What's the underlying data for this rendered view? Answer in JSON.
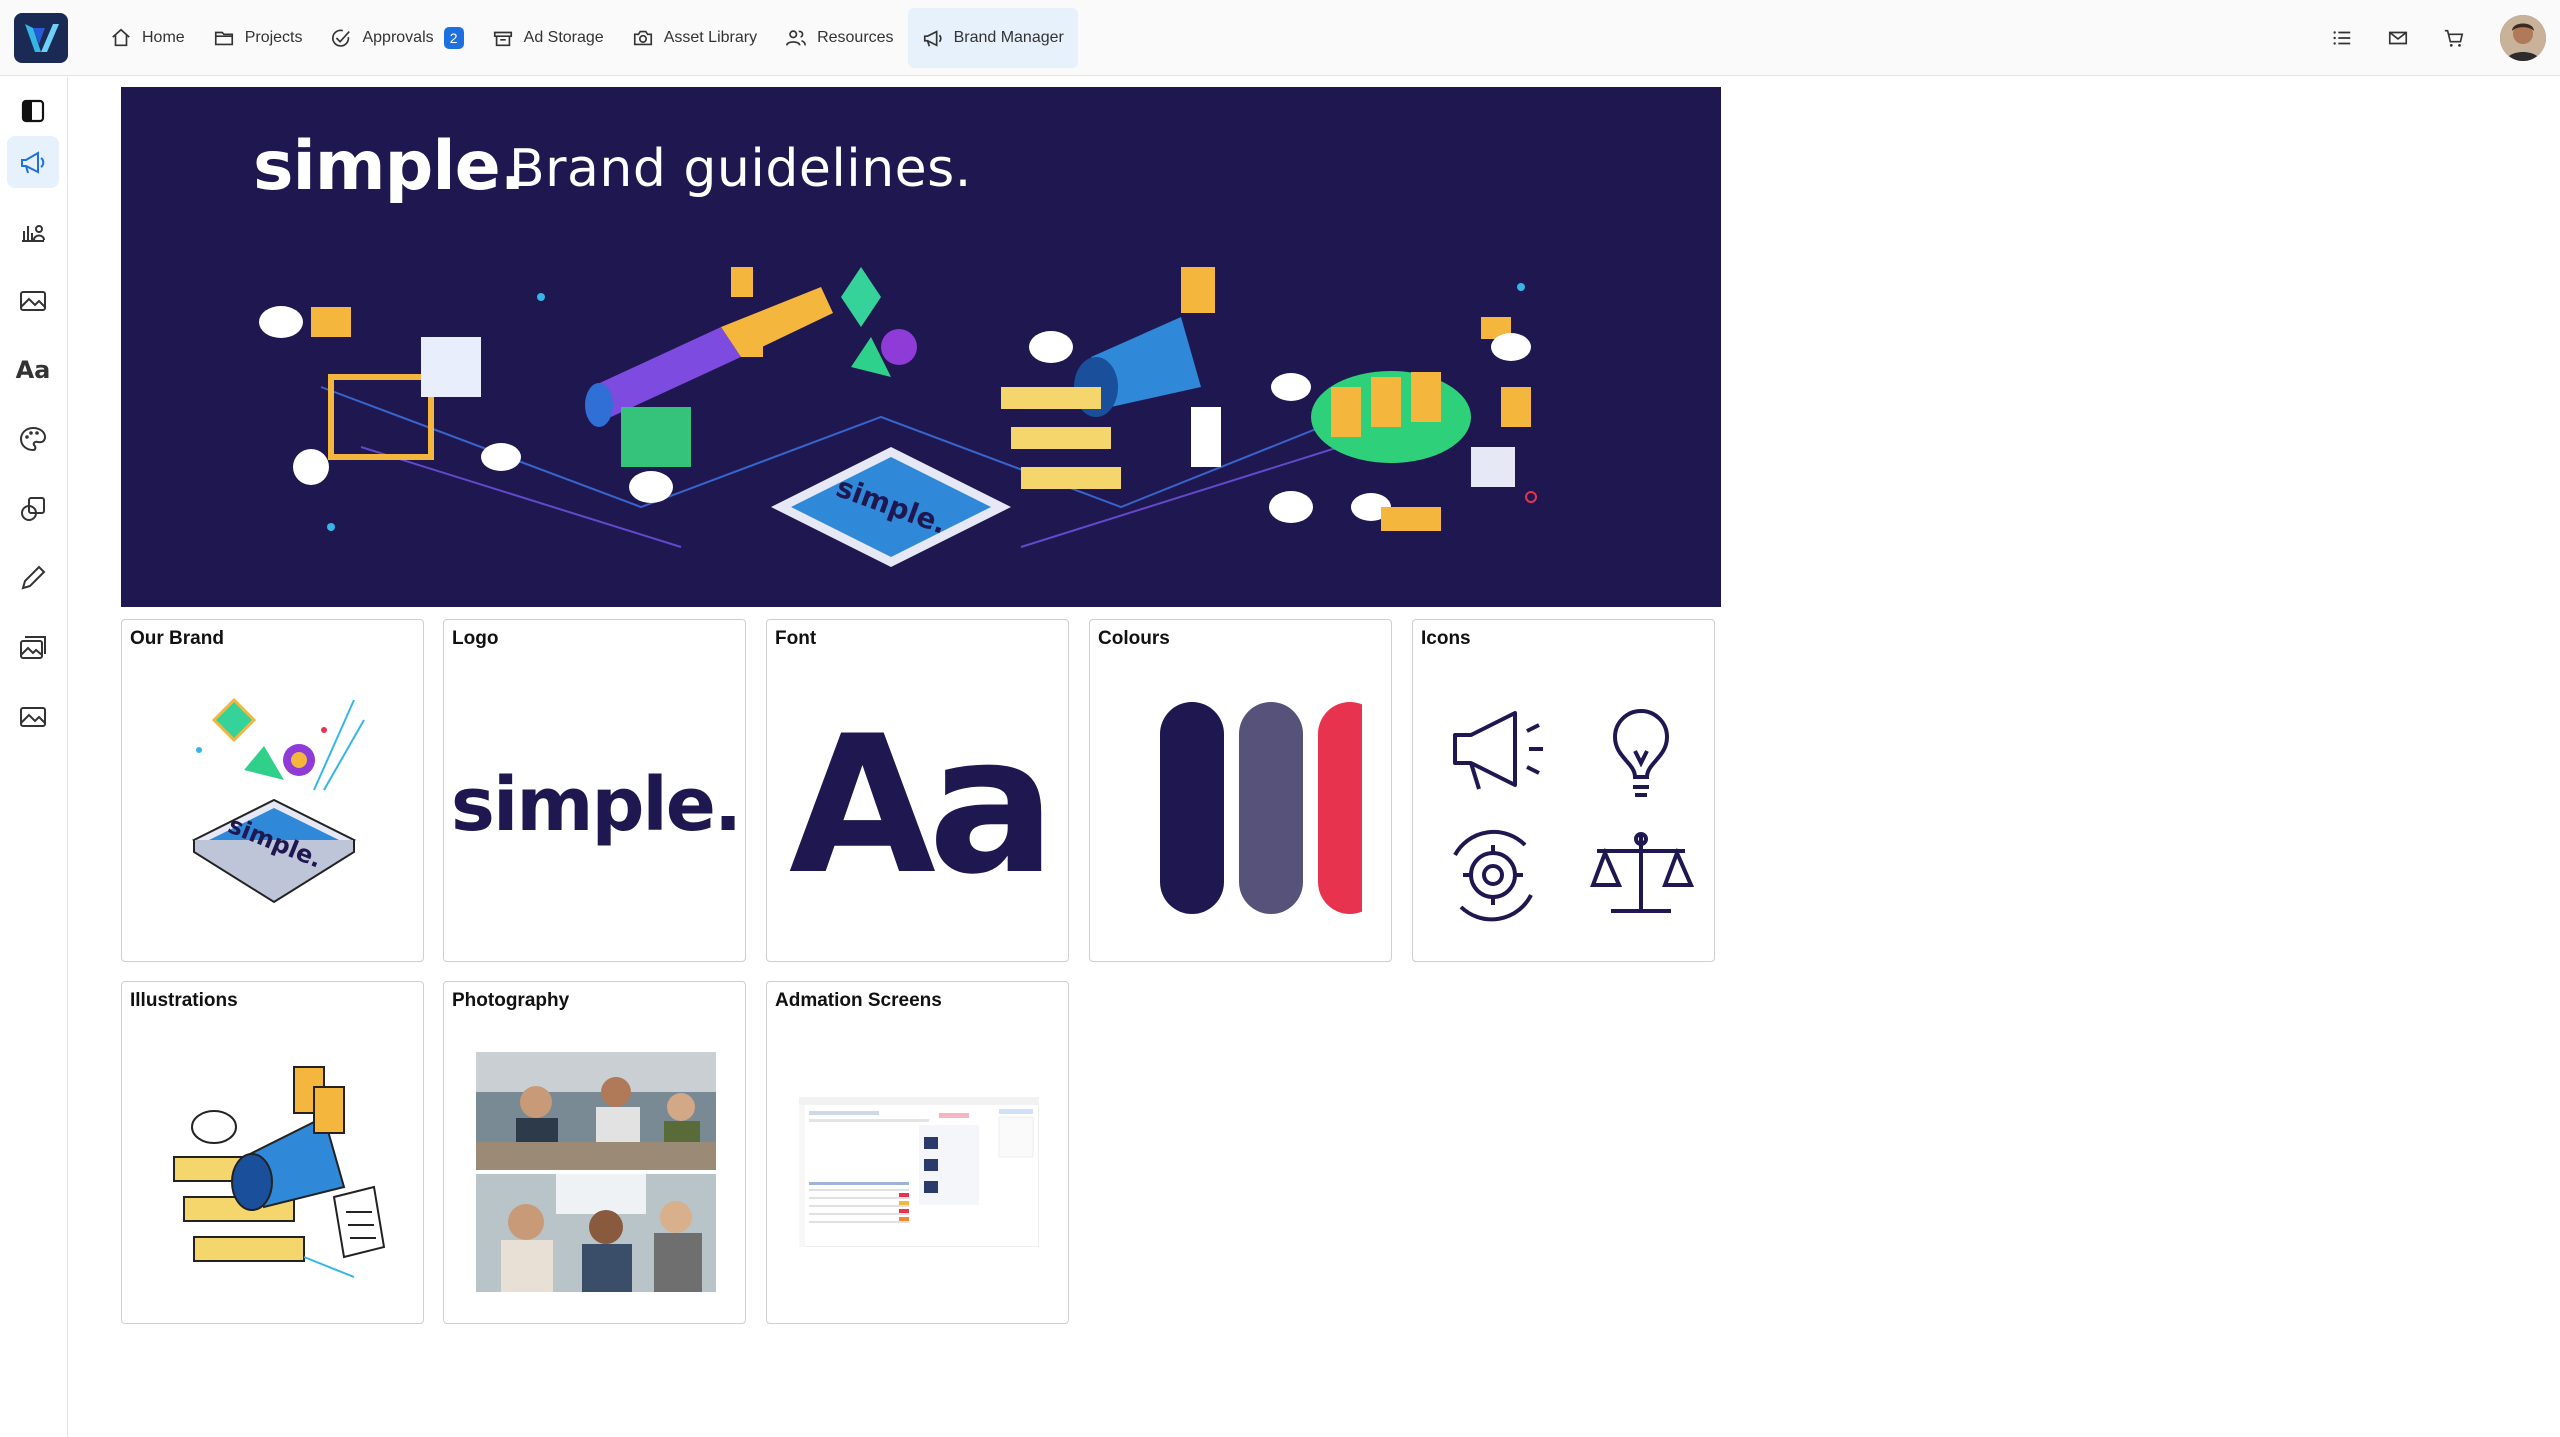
{
  "nav": {
    "items": [
      {
        "label": "Home",
        "icon": "home-icon"
      },
      {
        "label": "Projects",
        "icon": "folder-icon"
      },
      {
        "label": "Approvals",
        "icon": "check-circle-icon",
        "badge": "2"
      },
      {
        "label": "Ad Storage",
        "icon": "archive-icon"
      },
      {
        "label": "Asset Library",
        "icon": "camera-icon"
      },
      {
        "label": "Resources",
        "icon": "users-icon"
      },
      {
        "label": "Brand Manager",
        "icon": "megaphone-icon",
        "active": true
      }
    ]
  },
  "top_right": {
    "icons": [
      "list-icon",
      "mail-icon",
      "cart-icon",
      "avatar"
    ]
  },
  "sidebar": {
    "items": [
      "sidebar-toggle-icon",
      "megaphone-icon",
      "chart-people-icon",
      "image-icon",
      "font-icon",
      "palette-icon",
      "shapes-icon",
      "pen-icon",
      "photo-album-icon",
      "image-icon"
    ],
    "font_label": "Aa"
  },
  "hero": {
    "wordmark": "simple.",
    "title": "Brand guidelines."
  },
  "cards": [
    {
      "title": "Our Brand"
    },
    {
      "title": "Logo",
      "wordmark": "simple."
    },
    {
      "title": "Font",
      "sample": "Aa"
    },
    {
      "title": "Colours"
    },
    {
      "title": "Icons"
    },
    {
      "title": "Illustrations"
    },
    {
      "title": "Photography"
    },
    {
      "title": "Admation Screens"
    }
  ],
  "colors": {
    "brand_navy": "#1f1750",
    "brand_grey": "#57527a",
    "brand_red": "#e8334f",
    "accent_blue": "#1e6fe0"
  }
}
